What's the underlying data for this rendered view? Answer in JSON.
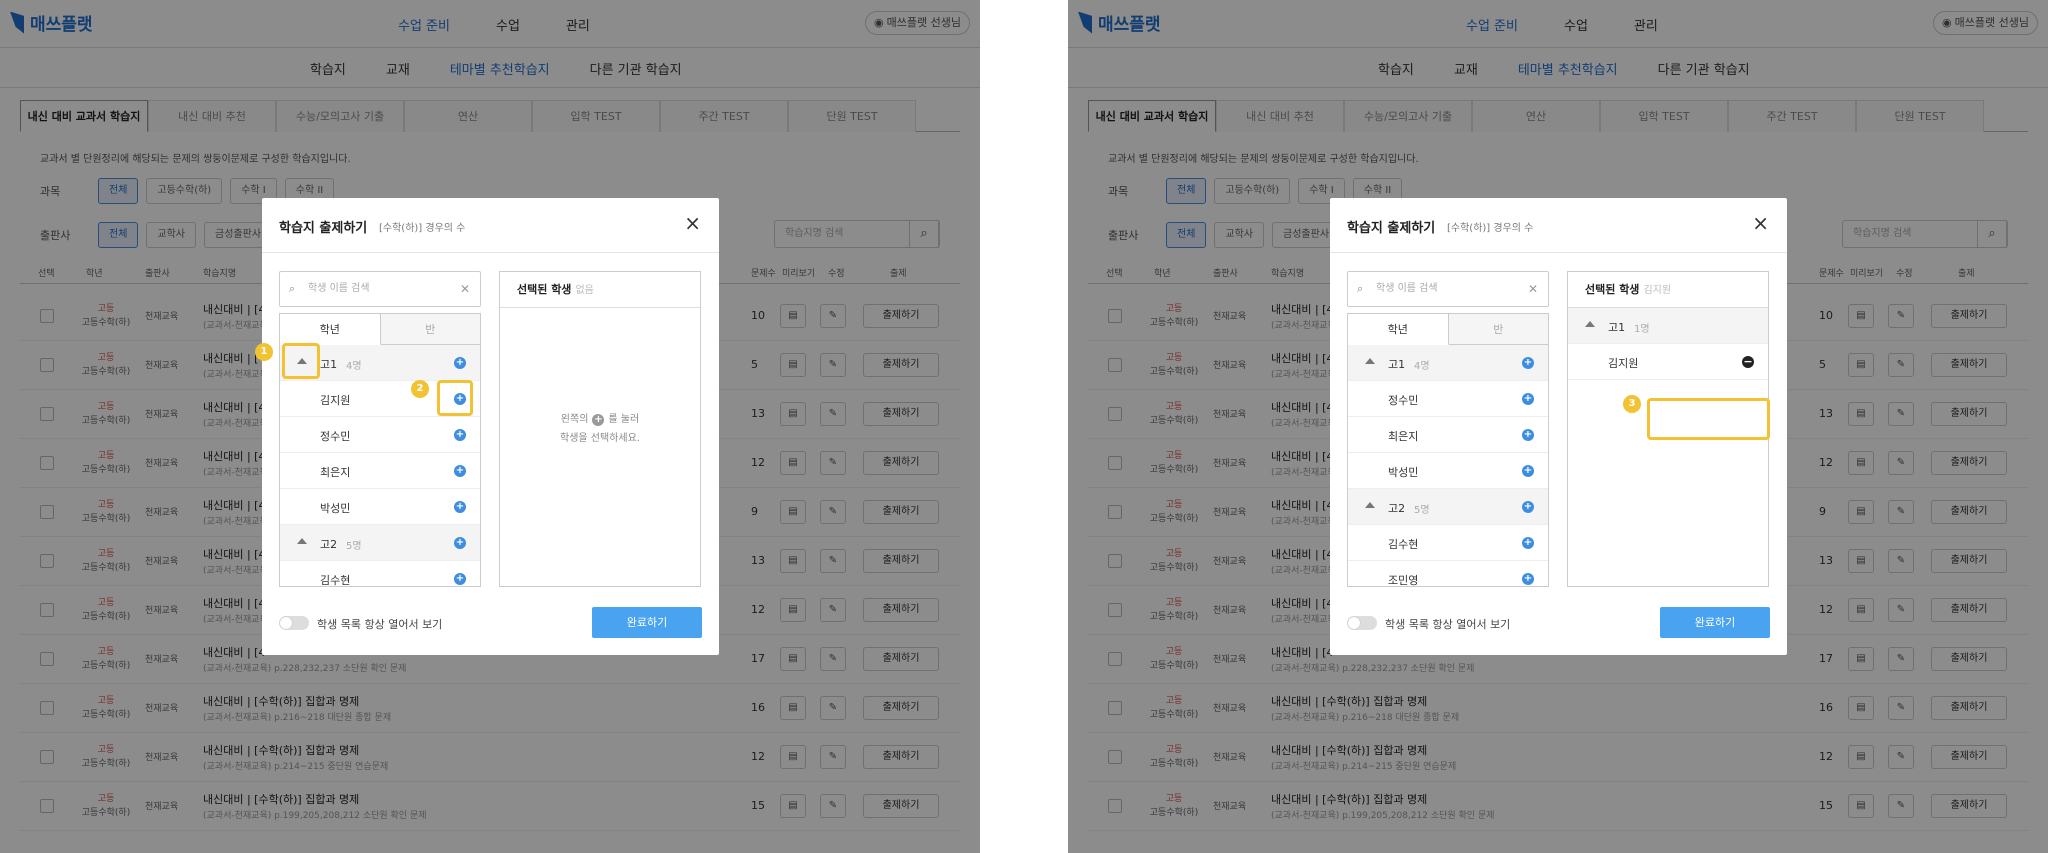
{
  "app": {
    "logo": "매쓰플랫",
    "main_menu": [
      "수업 준비",
      "수업",
      "관리"
    ],
    "user": "매쓰플랫 선생님",
    "sub_menu": [
      "학습지",
      "교재",
      "테마별 추천학습지",
      "다른 기관 학습지"
    ],
    "tabs": [
      "내신 대비 교과서 학습지",
      "내신 대비 추천",
      "수능/모의고사 기출",
      "연산",
      "입학 TEST",
      "주간 TEST",
      "단원 TEST"
    ],
    "description": "교과서 별 단원정리에 해당되는 문제의 쌍둥이문제로 구성한 학습지입니다.",
    "subject_label": "과목",
    "subject_chips": [
      "전체",
      "고등수학(하)",
      "수학 I",
      "수학 II"
    ],
    "publisher_label": "출판사",
    "publisher_chips": [
      "전체",
      "교학사",
      "금성출판사"
    ],
    "search_placeholder": "학습지명 검색",
    "columns": [
      "선택",
      "학년",
      "출판사",
      "학습지명",
      "문제수",
      "미리보기",
      "수정",
      "출제"
    ],
    "rows": [
      {
        "grade": "고등",
        "course": "고등수학(하)",
        "publisher": "천재교육",
        "title": "내신대비 | [4",
        "meta": "(교과서-천재교육) p.",
        "count": "10",
        "action": "출제하기"
      },
      {
        "grade": "고등",
        "course": "고등수학(하)",
        "publisher": "천재교육",
        "title": "내신대비 | [4",
        "meta": "(교과서-천재교육) p.",
        "count": "5",
        "action": "출제하기"
      },
      {
        "grade": "고등",
        "course": "고등수학(하)",
        "publisher": "천재교육",
        "title": "내신대비 | [4",
        "meta": "(교과서-천재교육) p.",
        "count": "13",
        "action": "출제하기"
      },
      {
        "grade": "고등",
        "course": "고등수학(하)",
        "publisher": "천재교육",
        "title": "내신대비 | [4",
        "meta": "(교과서-천재교육) p.",
        "count": "12",
        "action": "출제하기"
      },
      {
        "grade": "고등",
        "course": "고등수학(하)",
        "publisher": "천재교육",
        "title": "내신대비 | [4",
        "meta": "(교과서-천재교육) p.",
        "count": "9",
        "action": "출제하기"
      },
      {
        "grade": "고등",
        "course": "고등수학(하)",
        "publisher": "천재교육",
        "title": "내신대비 | [4",
        "meta": "(교과서-천재교육) p.",
        "count": "13",
        "action": "출제하기"
      },
      {
        "grade": "고등",
        "course": "고등수학(하)",
        "publisher": "천재교육",
        "title": "내신대비 | [4",
        "meta": "(교과서-천재교육) p.",
        "count": "12",
        "action": "출제하기"
      },
      {
        "grade": "고등",
        "course": "고등수학(하)",
        "publisher": "천재교육",
        "title": "내신대비 | [4",
        "meta": "(교과서-천재교육) p.228,232,237 소단원 확인 문제",
        "count": "17",
        "action": "출제하기"
      },
      {
        "grade": "고등",
        "course": "고등수학(하)",
        "publisher": "천재교육",
        "title": "내신대비 | [수학(하)] 집합과 명제",
        "meta": "(교과서-천재교육) p.216~218 대단원 종합 문제",
        "count": "16",
        "action": "출제하기"
      },
      {
        "grade": "고등",
        "course": "고등수학(하)",
        "publisher": "천재교육",
        "title": "내신대비 | [수학(하)] 집합과 명제",
        "meta": "(교과서-천재교육) p.214~215 중단원 연습문제",
        "count": "12",
        "action": "출제하기"
      },
      {
        "grade": "고등",
        "course": "고등수학(하)",
        "publisher": "천재교육",
        "title": "내신대비 | [수학(하)] 집합과 명제",
        "meta": "(교과서-천재교육) p.199,205,208,212 소단원 확인 문제",
        "count": "15",
        "action": "출제하기"
      }
    ]
  },
  "modal": {
    "title": "학습지 출제하기",
    "subtitle": "[수학(하)] 경우의 수",
    "close": "×",
    "search_placeholder": "학생 이름 검색",
    "tab_grade": "학년",
    "tab_class": "반",
    "selected_header": "선택된 학생",
    "toggle_label": "학생 목록 항상 열어서 보기",
    "done": "완료하기"
  },
  "left": {
    "selected_value": "없음",
    "empty_line1": "왼쪽의",
    "empty_line2": "를 눌러",
    "empty_line3": "학생을 선택하세요.",
    "list": [
      {
        "type": "group",
        "name": "고1",
        "count": "4명"
      },
      {
        "type": "student",
        "name": "김지원"
      },
      {
        "type": "student",
        "name": "정수민"
      },
      {
        "type": "student",
        "name": "최은지"
      },
      {
        "type": "student",
        "name": "박성민"
      },
      {
        "type": "group",
        "name": "고2",
        "count": "5명"
      },
      {
        "type": "student",
        "name": "김수현"
      }
    ]
  },
  "right": {
    "selected_value": "김지원",
    "selected_group": {
      "name": "고1",
      "count": "1명"
    },
    "selected_students": [
      "김지원"
    ],
    "list": [
      {
        "type": "group",
        "name": "고1",
        "count": "4명"
      },
      {
        "type": "student",
        "name": "정수민"
      },
      {
        "type": "student",
        "name": "최은지"
      },
      {
        "type": "student",
        "name": "박성민"
      },
      {
        "type": "group",
        "name": "고2",
        "count": "5명"
      },
      {
        "type": "student",
        "name": "김수현"
      },
      {
        "type": "student",
        "name": "조민영"
      }
    ]
  },
  "annotations": [
    "1",
    "2",
    "3"
  ],
  "colors": {
    "accent": "#1f6fcf",
    "primary_button": "#4aa3f0",
    "highlight": "#f2c233",
    "grade_red": "#d9534f"
  },
  "icons": [
    "logo-icon",
    "user-icon",
    "search-icon",
    "clear-icon",
    "close-icon",
    "expand-up-icon",
    "add-circle-icon",
    "remove-circle-icon",
    "preview-icon",
    "edit-icon"
  ]
}
